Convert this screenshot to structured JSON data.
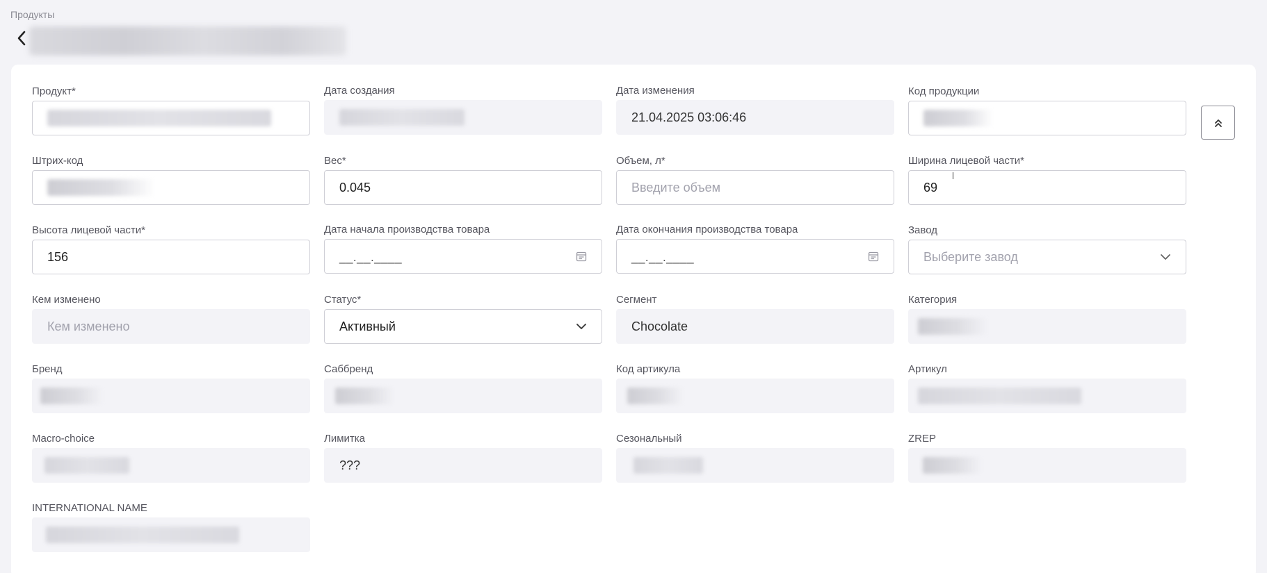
{
  "breadcrumb": "Продукты",
  "fields": {
    "product": {
      "label": "Продукт*"
    },
    "created_date": {
      "label": "Дата создания"
    },
    "modified_date": {
      "label": "Дата изменения",
      "value": "21.04.2025 03:06:46"
    },
    "product_code": {
      "label": "Код продукции"
    },
    "barcode": {
      "label": "Штрих-код"
    },
    "weight": {
      "label": "Вес*",
      "value": "0.045"
    },
    "volume": {
      "label": "Объем, л*",
      "placeholder": "Введите объем"
    },
    "face_width": {
      "label": "Ширина лицевой части*",
      "value": "69"
    },
    "face_height": {
      "label": "Высота лицевой части*",
      "value": "156"
    },
    "prod_start_date": {
      "label": "Дата начала производства товара",
      "mask": "__.__.____"
    },
    "prod_end_date": {
      "label": "Дата окончания производства товара",
      "mask": "__.__.____"
    },
    "plant": {
      "label": "Завод",
      "placeholder": "Выберите завод"
    },
    "modified_by": {
      "label": "Кем изменено",
      "placeholder": "Кем изменено"
    },
    "status": {
      "label": "Статус*",
      "value": "Активный"
    },
    "segment": {
      "label": "Сегмент",
      "value": "Chocolate"
    },
    "category": {
      "label": "Категория"
    },
    "brand": {
      "label": "Бренд"
    },
    "subbrand": {
      "label": "Саббренд"
    },
    "article_code": {
      "label": "Код артикула"
    },
    "article": {
      "label": "Артикул"
    },
    "macro_choice": {
      "label": "Macro-choice"
    },
    "limit": {
      "label": "Лимитка",
      "value": "???"
    },
    "seasonal": {
      "label": "Сезональный"
    },
    "zrep": {
      "label": "ZREP"
    },
    "international_name": {
      "label": "INTERNATIONAL NAME"
    }
  },
  "icons": {
    "back": "chevron-left-icon",
    "calendar": "calendar-icon",
    "dropdown": "chevron-down-icon",
    "collapse": "double-chevron-up-icon"
  },
  "colors": {
    "page_bg": "#f3f3f7",
    "card_bg": "#ffffff",
    "readonly_bg": "#f3f3f7",
    "border": "#cfcfd6"
  }
}
